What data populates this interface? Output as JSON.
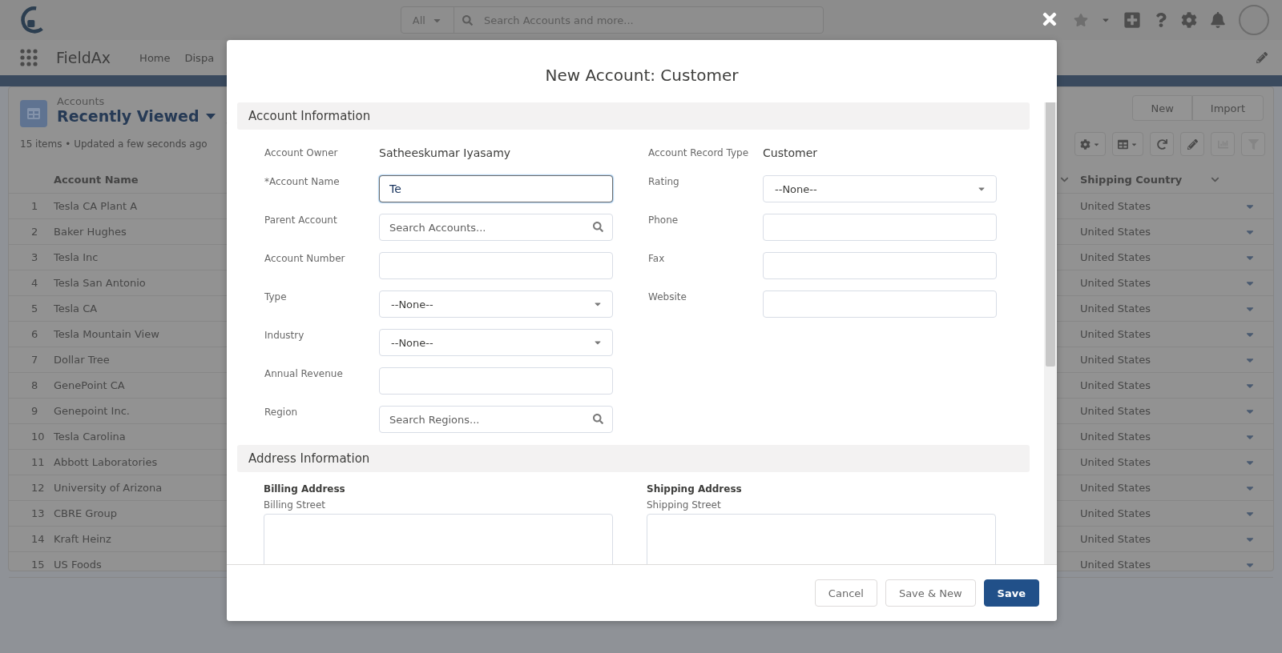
{
  "header": {
    "search_scope": "All",
    "search_placeholder": "Search Accounts and more..."
  },
  "nav": {
    "app_name": "FieldAx",
    "items": [
      "Home",
      "Dispa"
    ]
  },
  "list_view": {
    "object": "Accounts",
    "title": "Recently Viewed",
    "status": "15 items • Updated a few seconds ago",
    "buttons": [
      "New",
      "Import"
    ],
    "columns": [
      "Account Name",
      "Shipping Country"
    ],
    "rows": [
      {
        "number": "1",
        "name": "Tesla CA Plant A",
        "country": "United States"
      },
      {
        "number": "2",
        "name": "Baker Hughes",
        "country": "United States"
      },
      {
        "number": "3",
        "name": "Tesla Inc",
        "country": "United States"
      },
      {
        "number": "4",
        "name": "Tesla San Antonio",
        "country": "United States"
      },
      {
        "number": "5",
        "name": "Tesla CA",
        "country": "United States"
      },
      {
        "number": "6",
        "name": "Tesla Mountain View",
        "country": "United States"
      },
      {
        "number": "7",
        "name": "Dollar Tree",
        "country": "United States"
      },
      {
        "number": "8",
        "name": "GenePoint CA",
        "country": "United States"
      },
      {
        "number": "9",
        "name": "Genepoint Inc.",
        "country": "United States"
      },
      {
        "number": "10",
        "name": "Tesla Carolina",
        "country": "United States"
      },
      {
        "number": "11",
        "name": "Abbott Laboratories",
        "country": "United States"
      },
      {
        "number": "12",
        "name": "University of Arizona",
        "country": "United States"
      },
      {
        "number": "13",
        "name": "CBRE Group",
        "country": "United States"
      },
      {
        "number": "14",
        "name": "Kraft Heinz",
        "country": "United States"
      },
      {
        "number": "15",
        "name": "US Foods",
        "country": "United States"
      }
    ]
  },
  "modal": {
    "title": "New Account: Customer",
    "account_section": {
      "title": "Account Information",
      "left_fields": [
        {
          "kind": "readonly",
          "label": "Account Owner",
          "value": "Satheeskumar Iyasamy"
        },
        {
          "kind": "input",
          "label": "*Account Name",
          "value": "Te",
          "focused": true
        },
        {
          "kind": "lookup",
          "label": "Parent Account",
          "placeholder": "Search Accounts..."
        },
        {
          "kind": "input",
          "label": "Account Number",
          "focused": false
        },
        {
          "kind": "picklist",
          "label": "Type",
          "value": "--None--"
        },
        {
          "kind": "picklist",
          "label": "Industry",
          "value": "--None--"
        },
        {
          "kind": "input",
          "label": "Annual Revenue",
          "focused": false
        },
        {
          "kind": "lookup",
          "label": "Region",
          "placeholder": "Search Regions..."
        }
      ],
      "right_fields": [
        {
          "kind": "readonly",
          "label": "Account Record Type",
          "value": "Customer"
        },
        {
          "kind": "picklist",
          "label": "Rating",
          "value": "--None--"
        },
        {
          "kind": "input",
          "label": "Phone",
          "focused": false
        },
        {
          "kind": "input",
          "label": "Fax",
          "focused": false
        },
        {
          "kind": "input",
          "label": "Website",
          "focused": false
        }
      ]
    },
    "address_section": {
      "title": "Address Information",
      "columns": [
        {
          "heading": "Billing Address",
          "field_label": "Billing Street"
        },
        {
          "heading": "Shipping Address",
          "field_label": "Shipping Street"
        }
      ]
    },
    "buttons": [
      {
        "label": "Cancel",
        "kind": "neutral"
      },
      {
        "label": "Save & New",
        "kind": "neutral"
      },
      {
        "label": "Save",
        "kind": "primary"
      }
    ]
  }
}
